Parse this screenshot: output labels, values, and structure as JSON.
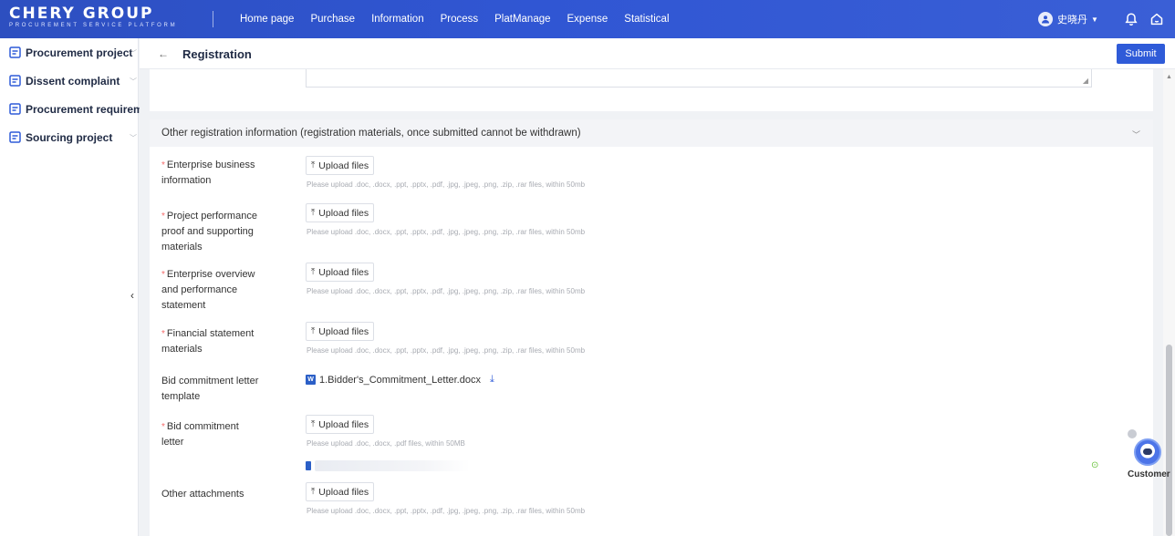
{
  "brand": {
    "title": "CHERY GROUP",
    "subtitle": "PROCUREMENT SERVICE PLATFORM"
  },
  "nav": [
    "Home page",
    "Purchase",
    "Information",
    "Process",
    "PlatManage",
    "Expense",
    "Statistical"
  ],
  "user": {
    "name": "史晓丹"
  },
  "sidebar": {
    "items": [
      {
        "label": "Procurement project",
        "has_caret": true
      },
      {
        "label": "Dissent complaint",
        "has_caret": true
      },
      {
        "label": "Procurement requirement",
        "has_caret": false
      },
      {
        "label": "Sourcing project",
        "has_caret": true
      }
    ]
  },
  "header": {
    "title": "Registration",
    "submit_label": "Submit"
  },
  "section": {
    "title": "Other registration information (registration materials, once submitted cannot be withdrawn)"
  },
  "upload_label": "Upload files",
  "fields": [
    {
      "label": "Enterprise business information",
      "required": true,
      "hint": "Please upload .doc, .docx, .ppt, .pptx, .pdf, .jpg, .jpeg, .png, .zip, .rar files, within 50mb"
    },
    {
      "label": "Project performance proof and supporting materials",
      "required": true,
      "hint": "Please upload .doc, .docx, .ppt, .pptx, .pdf, .jpg, .jpeg, .png, .zip, .rar files, within 50mb"
    },
    {
      "label": "Enterprise overview and performance statement",
      "required": true,
      "hint": "Please upload .doc, .docx, .ppt, .pptx, .pdf, .jpg, .jpeg, .png, .zip, .rar files, within 50mb"
    },
    {
      "label": "Financial statement materials",
      "required": true,
      "hint": "Please upload .doc, .docx, .ppt, .pptx, .pdf, .jpg, .jpeg, .png, .zip, .rar files, within 50mb"
    },
    {
      "label": "Bid commitment letter template",
      "required": false,
      "file_name": "1.Bidder's_Commitment_Letter.docx"
    },
    {
      "label": "Bid commitment letter",
      "required": true,
      "hint": "Please upload .doc, .docx, .pdf files, within 50MB"
    },
    {
      "label": "Other attachments",
      "required": false,
      "hint": "Please upload .doc, .docx, .ppt, .pptx, .pdf, .jpg, .jpeg, .png, .zip, .rar files, within 50mb"
    }
  ],
  "customer_service": {
    "label": "Customer"
  },
  "colors": {
    "primary": "#2f5bd8",
    "topbar": "#3056d3",
    "required": "#f56c6c",
    "success": "#67c23a"
  },
  "icons": {
    "doc": "document-icon",
    "upload": "upload-arrow-icon",
    "download": "download-icon",
    "word": "word-file-icon"
  }
}
